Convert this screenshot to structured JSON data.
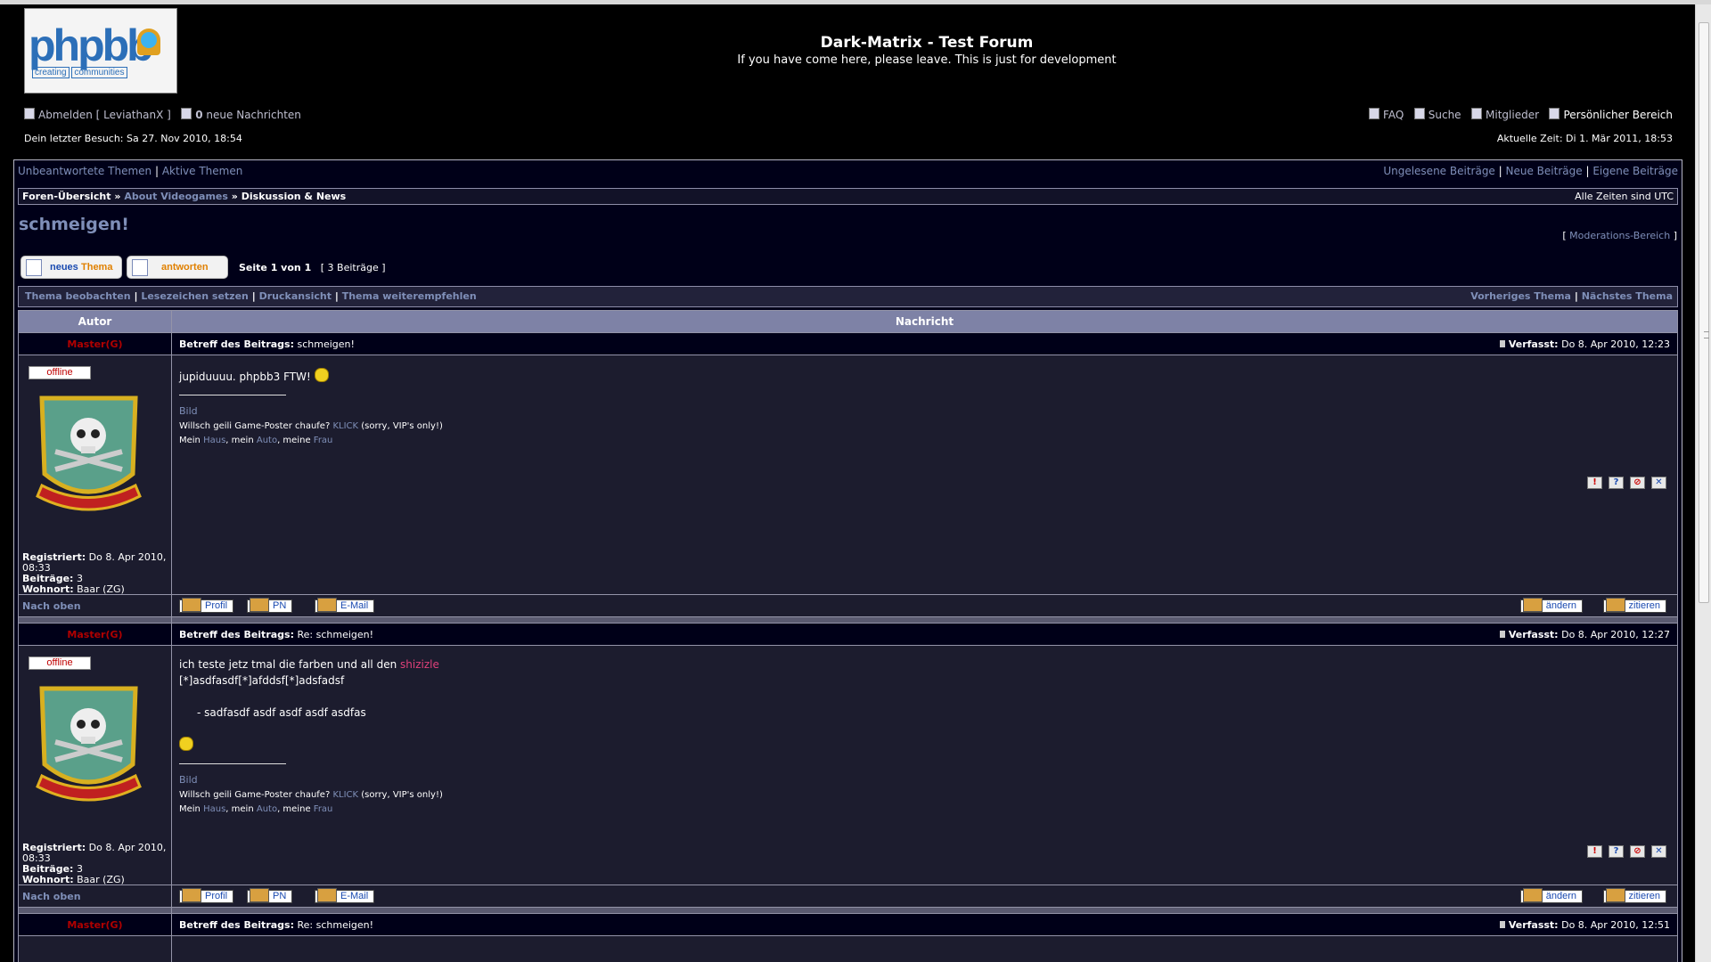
{
  "site": {
    "title": "Dark-Matrix - Test Forum",
    "description": "If you have come here, please leave. This is just for development",
    "logo_text": "phpbb",
    "logo_tagline_1": "creating",
    "logo_tagline_2": "communities"
  },
  "usernav": {
    "logout": "Abmelden [ LeviathanX ]",
    "messages_count": "0",
    "messages_label": "neue Nachrichten",
    "faq": "FAQ",
    "search": "Suche",
    "members": "Mitglieder",
    "personal": "Persönlicher Bereich",
    "last_visit": "Dein letzter Besuch: Sa 27. Nov 2010, 18:54",
    "current_time": "Aktuelle Zeit: Di 1. Mär 2011, 18:53"
  },
  "linkbar": {
    "unanswered": "Unbeantwortete Themen",
    "active": "Aktive Themen",
    "sep": "|",
    "unread": "Ungelesene Beiträge",
    "new_posts": "Neue Beiträge",
    "own_posts": "Eigene Beiträge"
  },
  "breadcrumb": {
    "index": "Foren-Übersicht",
    "arrow": "»",
    "category": "About Videogames",
    "forum": "Diskussion & News",
    "timezone": "Alle Zeiten sind UTC"
  },
  "topic": {
    "title": "schmeigen!",
    "moderation": "Moderations-Bereich",
    "bracket_open": "[",
    "bracket_close": "]",
    "new_topic_1": "neues",
    "new_topic_2": "Thema",
    "reply": "antworten",
    "page_info": "Seite 1 von 1",
    "post_count": "[ 3 Beiträge ]"
  },
  "actions": {
    "watch": "Thema beobachten",
    "bookmark": "Lesezeichen setzen",
    "print": "Druckansicht",
    "recommend": "Thema weiterempfehlen",
    "prev": "Vorheriges Thema",
    "next": "Nächstes Thema"
  },
  "table": {
    "col_author": "Autor",
    "col_message": "Nachricht"
  },
  "labels": {
    "subject": "Betreff des Beitrags:",
    "posted": "Verfasst:",
    "registered": "Registriert:",
    "posts": "Beiträge:",
    "location": "Wohnort:",
    "offline": "offline",
    "top": "Nach oben",
    "profile": "Profil",
    "pm": "PN",
    "email": "E-Mail",
    "edit": "ändern",
    "quote": "zitieren"
  },
  "posts": [
    {
      "author": "Master(G)",
      "subject": "schmeigen!",
      "date": "Do 8. Apr 2010, 12:23",
      "body_line_1": "jupiduuuu. phpbb3 FTW!",
      "registered": "Do 8. Apr 2010, 08:33",
      "post_count": "3",
      "location": "Baar (ZG)"
    },
    {
      "author": "Master(G)",
      "subject": "Re: schmeigen!",
      "date": "Do 8. Apr 2010, 12:27",
      "body_line_1": "ich teste jetz tmal die farben und all den",
      "body_highlight": "shizizle",
      "body_line_2": "[*]asdfasdf[*]afddsf[*]adsfadsf",
      "body_line_3": "- sadfasdf asdf asdf asdf asdfas",
      "registered": "Do 8. Apr 2010, 08:33",
      "post_count": "3",
      "location": "Baar (ZG)"
    },
    {
      "author": "Master(G)",
      "subject": "Re: schmeigen!",
      "date": "Do 8. Apr 2010, 12:51"
    }
  ],
  "signature": {
    "image_link": "Bild",
    "line1_a": "Willsch geili Game-Poster chaufe?",
    "line1_link": "KLICK",
    "line1_b": "(sorry, VIP's only!)",
    "line2_a": "Mein",
    "line2_link1": "Haus",
    "line2_b": ", mein",
    "line2_link2": "Auto",
    "line2_c": ", meine",
    "line2_link3": "Frau"
  },
  "colors": {
    "link": "#7f8fb8",
    "author": "#b00000",
    "highlight": "#e0407a",
    "header_bg": "#7e82a6"
  }
}
